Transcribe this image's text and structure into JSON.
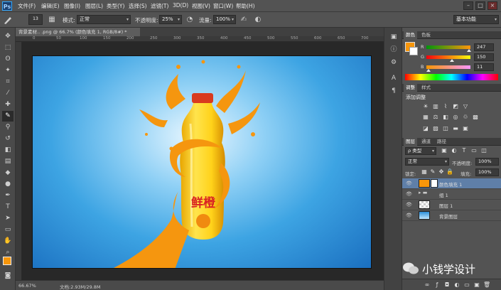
{
  "menubar": {
    "logo": "Ps",
    "items": [
      "文件(F)",
      "编辑(E)",
      "图像(I)",
      "图层(L)",
      "类型(Y)",
      "选择(S)",
      "滤镜(T)",
      "3D(D)",
      "视图(V)",
      "窗口(W)",
      "帮助(H)"
    ],
    "controls": [
      "–",
      "□",
      "×"
    ]
  },
  "options": {
    "brush_size": "13",
    "mode_label": "模式:",
    "mode_value": "正常",
    "opacity_label": "不透明度:",
    "opacity_value": "25%",
    "flow_label": "流量:",
    "flow_value": "100%",
    "workspace": "基本功能"
  },
  "document": {
    "tab_title": "背景素材.. .png @ 66.7% (颜色填充 1, RGB/8#) *",
    "ruler_ticks": [
      "0",
      "50",
      "100",
      "150",
      "200",
      "250",
      "300",
      "350",
      "400",
      "450",
      "500",
      "550",
      "600",
      "650",
      "700"
    ],
    "zoom": "66.67%",
    "doc_size": "文档:2.93M/29.8M",
    "bottle_label": "鲜橙"
  },
  "color_panel": {
    "tabs": [
      "颜色",
      "色板"
    ],
    "channels": [
      {
        "name": "R",
        "value": "247",
        "level": 0.969
      },
      {
        "name": "G",
        "value": "150",
        "level": 0.588
      },
      {
        "name": "B",
        "value": "11",
        "level": 0.043
      }
    ],
    "foreground": "#f7960b"
  },
  "adjust_panel": {
    "tabs": [
      "调整",
      "样式"
    ],
    "title": "添加调整"
  },
  "layers_panel": {
    "tabs": [
      "图层",
      "通道",
      "路径"
    ],
    "filter_label": "ρ 类型",
    "blend_mode": "正常",
    "opacity_label": "不透明度:",
    "opacity_value": "100%",
    "lock_label": "锁定:",
    "fill_label": "填充:",
    "fill_value": "100%",
    "layers": [
      {
        "name": "颜色填充 1",
        "selected": true
      },
      {
        "name": "组 1",
        "selected": false
      },
      {
        "name": "图层 1",
        "selected": false
      },
      {
        "name": "背景图层",
        "selected": false
      }
    ]
  },
  "watermark": {
    "text": "小钱学设计"
  }
}
